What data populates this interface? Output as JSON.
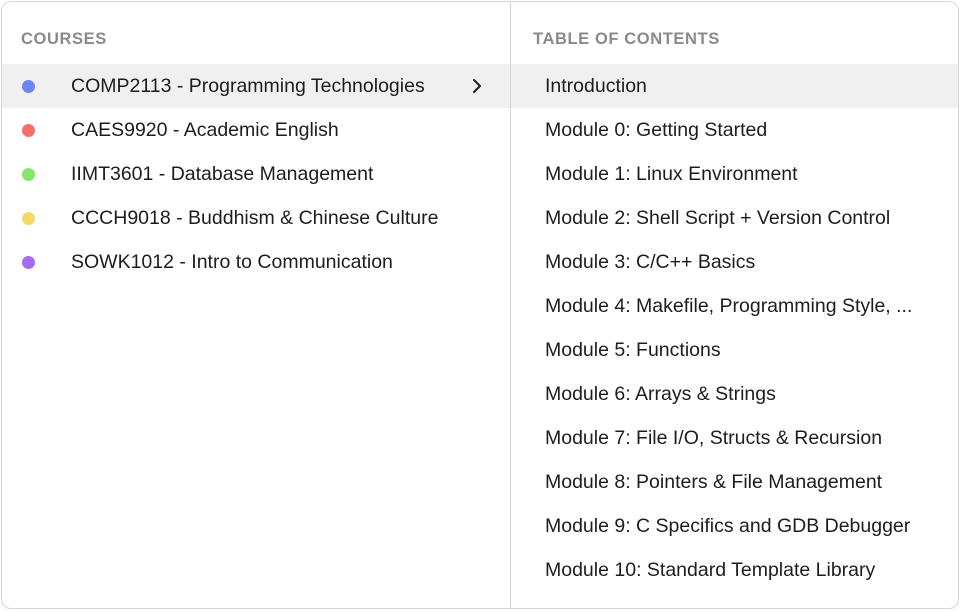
{
  "courses_panel": {
    "header": "COURSES",
    "items": [
      {
        "label": "COMP2113 - Programming Technologies",
        "color": "#6e86f2",
        "selected": true
      },
      {
        "label": "CAES9920 - Academic English",
        "color": "#f2706a",
        "selected": false
      },
      {
        "label": "IIMT3601 - Database Management",
        "color": "#86e66c",
        "selected": false
      },
      {
        "label": "CCCH9018 - Buddhism & Chinese Culture",
        "color": "#f6d86a",
        "selected": false
      },
      {
        "label": "SOWK1012 - Intro to Communication",
        "color": "#a56cf2",
        "selected": false
      }
    ],
    "selected_indicator_icon": "chevron-right-icon"
  },
  "toc_panel": {
    "header": "TABLE OF CONTENTS",
    "items": [
      {
        "label": "Introduction",
        "selected": true
      },
      {
        "label": "Module 0: Getting Started",
        "selected": false
      },
      {
        "label": "Module 1: Linux Environment",
        "selected": false
      },
      {
        "label": "Module 2: Shell Script + Version Control",
        "selected": false
      },
      {
        "label": "Module 3: C/C++ Basics",
        "selected": false
      },
      {
        "label": "Module 4: Makefile, Programming Style, ...",
        "selected": false
      },
      {
        "label": "Module 5: Functions",
        "selected": false
      },
      {
        "label": "Module 6: Arrays & Strings",
        "selected": false
      },
      {
        "label": "Module 7: File I/O, Structs & Recursion",
        "selected": false
      },
      {
        "label": "Module 8: Pointers & File Management",
        "selected": false
      },
      {
        "label": "Module 9: C Specifics and GDB Debugger",
        "selected": false
      },
      {
        "label": "Module 10: Standard Template Library",
        "selected": false
      }
    ]
  },
  "colors": {
    "selected_row_bg": "#f0f0f0",
    "header_text": "#8a8a8e",
    "border": "#d6d6d6"
  }
}
